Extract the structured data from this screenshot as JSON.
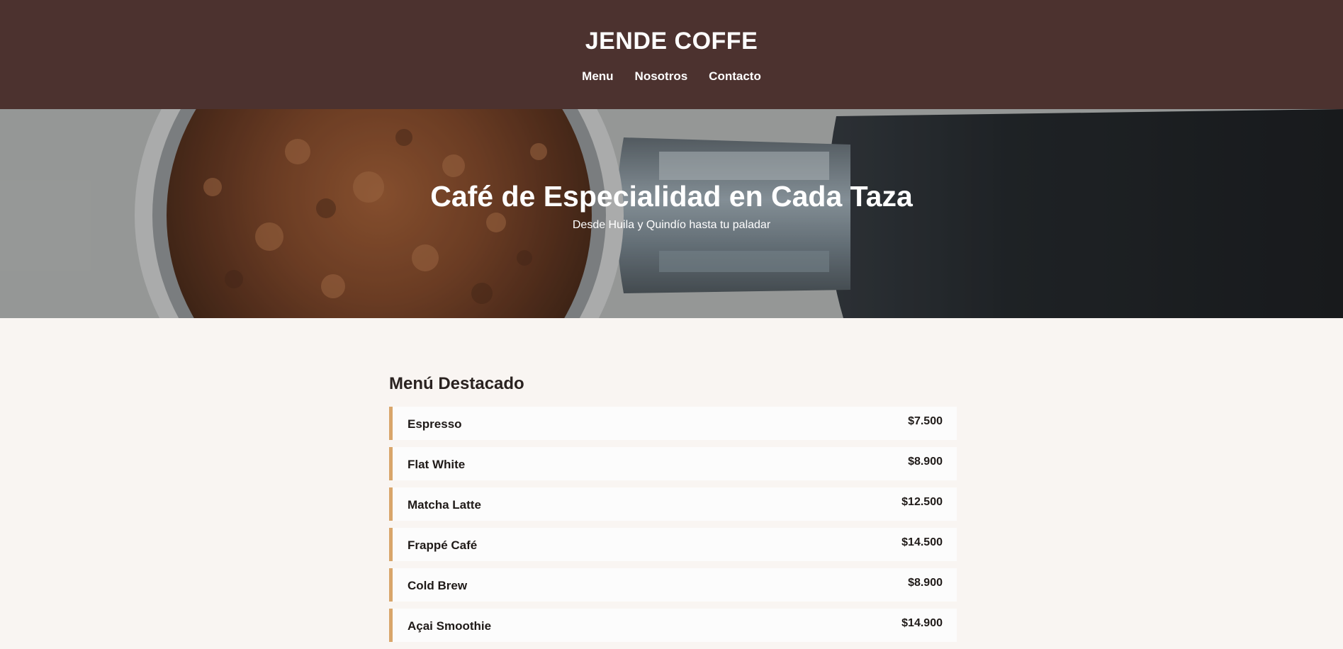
{
  "header": {
    "title": "JENDE COFFE",
    "nav": [
      "Menu",
      "Nosotros",
      "Contacto"
    ]
  },
  "hero": {
    "title": "Café de Especialidad en Cada Taza",
    "subtitle": "Desde Huila y Quindío hasta tu paladar"
  },
  "menu": {
    "heading": "Menú Destacado",
    "items": [
      {
        "name": "Espresso",
        "price": "$7.500"
      },
      {
        "name": "Flat White",
        "price": "$8.900"
      },
      {
        "name": "Matcha Latte",
        "price": "$12.500"
      },
      {
        "name": "Frappé Café",
        "price": "$14.500"
      },
      {
        "name": "Cold Brew",
        "price": "$8.900"
      },
      {
        "name": "Açai Smoothie",
        "price": "$14.900"
      }
    ]
  },
  "colors": {
    "header_bg": "#4c322f",
    "page_bg": "#f9f5f2",
    "accent": "#d9a66b",
    "item_bg": "#fcfcfc"
  }
}
